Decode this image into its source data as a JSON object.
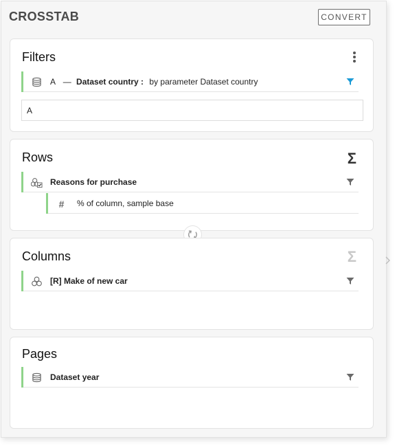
{
  "panel": {
    "title": "CROSSTAB",
    "convert_label": "CONVERT"
  },
  "filters": {
    "title": "Filters",
    "item": {
      "prefix": "A",
      "dash": "—",
      "name": "Dataset country :",
      "detail": "by parameter Dataset country"
    },
    "input_value": "A"
  },
  "rows": {
    "title": "Rows",
    "item": {
      "label": "Reasons for purchase"
    },
    "measure": {
      "label": "% of column, sample base"
    }
  },
  "columns": {
    "title": "Columns",
    "item": {
      "label": "[R] Make of new car"
    }
  },
  "pages": {
    "title": "Pages",
    "item": {
      "label": "Dataset year"
    }
  },
  "icons": {
    "sigma": "sigma-icon",
    "funnel_active": "funnel-filled-icon",
    "funnel": "funnel-icon",
    "swap": "swap-icon"
  },
  "colors": {
    "accent_bar": "#8fd48a",
    "active_filter": "#1b9ad6",
    "sigma_active": "#333333",
    "sigma_disabled": "#c8c8c8"
  }
}
